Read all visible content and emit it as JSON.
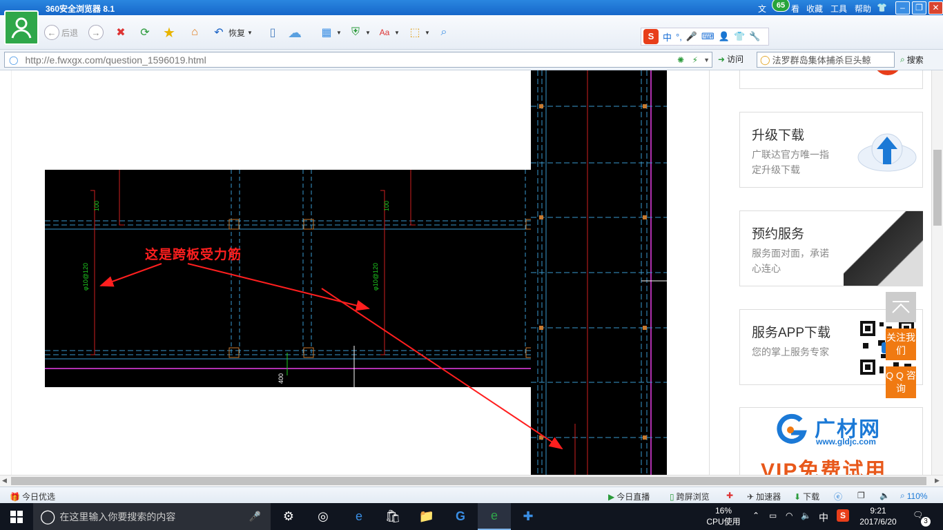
{
  "window": {
    "title": "360安全浏览器 8.1",
    "menus": [
      "文",
      "看",
      "收藏",
      "工具",
      "帮助"
    ],
    "badge": "65"
  },
  "toolbar": {
    "back": "后退",
    "restore": "恢复"
  },
  "ime": {
    "lang": "中"
  },
  "address": {
    "url": "http://e.fwxgx.com/question_1596019.html",
    "visit": "访问",
    "search_value": "法罗群岛集体捕杀巨头鲸",
    "search_btn": "搜索"
  },
  "annotation": "这是跨板受力筋",
  "cad_labels": {
    "dim1": "100",
    "dim2": "100",
    "rebar1": "φ10@120",
    "rebar2": "φ10@120",
    "bottom": "400"
  },
  "sidebar": {
    "cards": [
      {
        "title": "升级下载",
        "desc": "广联达官方唯一指定升级下载"
      },
      {
        "title": "预约服务",
        "desc": "服务面对面，承诺心连心"
      },
      {
        "title": "服务APP下载",
        "desc": "您的掌上服务专家"
      }
    ],
    "float_follow": "关注我们",
    "float_qq": "Q Q 咨询",
    "ad_brand": "广材网",
    "ad_url": "www.gldjc.com",
    "ad_vip": "VIP免费试用"
  },
  "statusbar": {
    "today": "今日优选",
    "live": "今日直播",
    "cross": "跨屏浏览",
    "accel": "加速器",
    "download": "下载",
    "zoom": "110%"
  },
  "taskbar": {
    "search_placeholder": "在这里输入你要搜索的内容",
    "cpu": "16%",
    "cpu_label": "CPU使用",
    "ime": "中",
    "time": "9:21",
    "date": "2017/6/20",
    "notif": "3"
  }
}
